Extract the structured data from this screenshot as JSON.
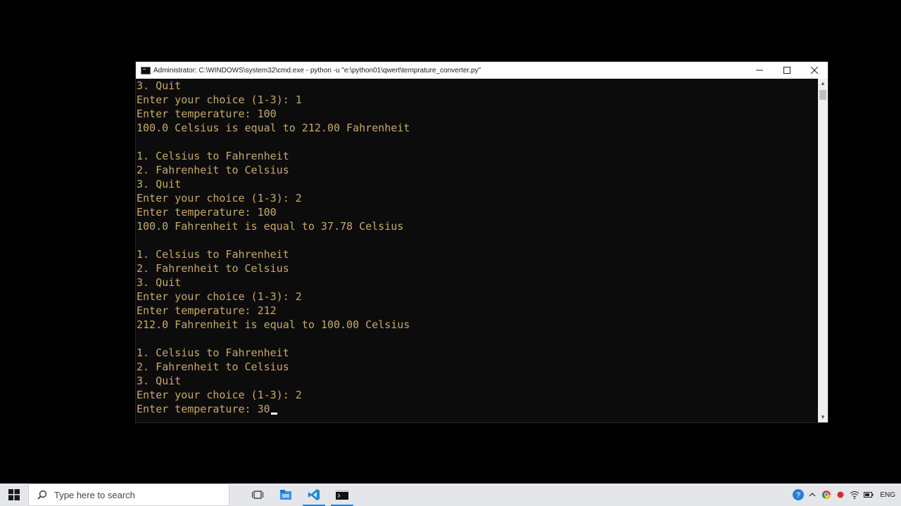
{
  "window": {
    "title": "Administrator: C:\\WINDOWS\\system32\\cmd.exe - python  -u \"e:\\python01\\qwert\\temprature_converter.py\"",
    "controls": {
      "minimize": "—",
      "maximize": "☐",
      "close": "✕"
    }
  },
  "terminal": {
    "lines": [
      "3. Quit",
      "Enter your choice (1-3): 1",
      "Enter temperature: 100",
      "100.0 Celsius is equal to 212.00 Fahrenheit",
      "",
      "1. Celsius to Fahrenheit",
      "2. Fahrenheit to Celsius",
      "3. Quit",
      "Enter your choice (1-3): 2",
      "Enter temperature: 100",
      "100.0 Fahrenheit is equal to 37.78 Celsius",
      "",
      "1. Celsius to Fahrenheit",
      "2. Fahrenheit to Celsius",
      "3. Quit",
      "Enter your choice (1-3): 2",
      "Enter temperature: 212",
      "212.0 Fahrenheit is equal to 100.00 Celsius",
      "",
      "1. Celsius to Fahrenheit",
      "2. Fahrenheit to Celsius",
      "3. Quit",
      "Enter your choice (1-3): 2",
      "Enter temperature: 30"
    ],
    "text_color": "#c8a96a",
    "background": "#0c0c0c"
  },
  "taskbar": {
    "search_placeholder": "Type here to search",
    "apps": [
      {
        "icon": "task-view-icon",
        "active": false
      },
      {
        "icon": "file-explorer-icon",
        "active": false
      },
      {
        "icon": "vscode-icon",
        "active": true
      },
      {
        "icon": "cmd-icon",
        "active": true
      }
    ],
    "tray": {
      "icons": [
        "help-icon",
        "chevron-up-icon",
        "chrome-icon",
        "record-icon",
        "wifi-icon",
        "battery-icon"
      ],
      "language": "ENG"
    }
  }
}
